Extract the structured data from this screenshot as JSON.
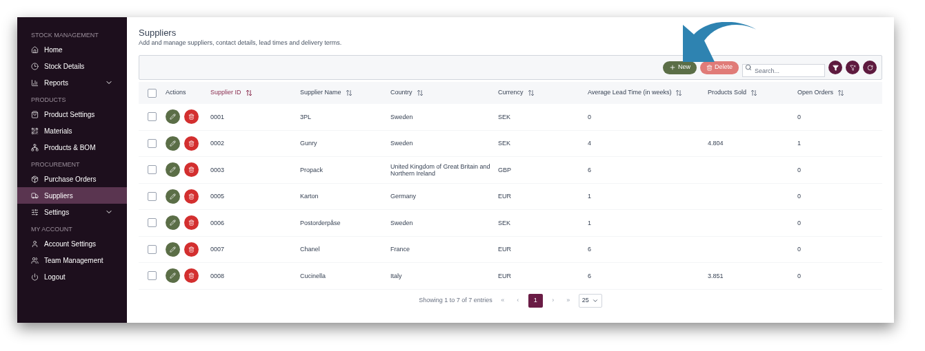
{
  "sidebar": {
    "sections": [
      {
        "title": "STOCK MANAGEMENT",
        "items": [
          {
            "label": "Home",
            "selected": false,
            "has_submenu": false
          },
          {
            "label": "Stock Details",
            "selected": false,
            "has_submenu": false
          },
          {
            "label": "Reports",
            "selected": false,
            "has_submenu": true
          }
        ]
      },
      {
        "title": "PRODUCTS",
        "items": [
          {
            "label": "Product Settings",
            "selected": false,
            "has_submenu": false
          },
          {
            "label": "Materials",
            "selected": false,
            "has_submenu": false
          },
          {
            "label": "Products & BOM",
            "selected": false,
            "has_submenu": false
          }
        ]
      },
      {
        "title": "PROCUREMENT",
        "items": [
          {
            "label": "Purchase Orders",
            "selected": false,
            "has_submenu": false
          },
          {
            "label": "Suppliers",
            "selected": true,
            "has_submenu": false
          },
          {
            "label": "Settings",
            "selected": false,
            "has_submenu": true
          }
        ]
      },
      {
        "title": "MY ACCOUNT",
        "items": [
          {
            "label": "Account Settings",
            "selected": false,
            "has_submenu": false
          },
          {
            "label": "Team Management",
            "selected": false,
            "has_submenu": false
          },
          {
            "label": "Logout",
            "selected": false,
            "has_submenu": false
          }
        ]
      }
    ]
  },
  "page": {
    "title": "Suppliers",
    "subtitle": "Add and manage suppliers, contact details, lead times and delivery terms."
  },
  "toolbar": {
    "new_button": {
      "label": "New"
    },
    "delete_button": {
      "label": "Delete",
      "disabled": true
    },
    "search": {
      "placeholder": "Search..."
    }
  },
  "table": {
    "select_all": {
      "checked": false
    },
    "actions_column": {
      "label": "Actions"
    },
    "columns": [
      {
        "label": "Supplier ID",
        "sorted": true
      },
      {
        "label": "Supplier Name",
        "sorted": false
      },
      {
        "label": "Country",
        "sorted": false
      },
      {
        "label": "Currency",
        "sorted": false
      },
      {
        "label": "Average Lead Time (in weeks)",
        "sorted": false
      },
      {
        "label": "Products Sold",
        "sorted": false
      },
      {
        "label": "Open Orders",
        "sorted": false
      }
    ],
    "rows": [
      {
        "checked": false,
        "cells": [
          "0001",
          "3PL",
          "Sweden",
          "SEK",
          "0",
          null,
          "0"
        ]
      },
      {
        "checked": false,
        "cells": [
          "0002",
          "Gunry",
          "Sweden",
          "SEK",
          "4",
          "4.804",
          "1"
        ]
      },
      {
        "checked": false,
        "cells": [
          "0003",
          "Propack",
          "United Kingdom of Great Britain and Northern Ireland",
          "GBP",
          "6",
          null,
          "0"
        ]
      },
      {
        "checked": false,
        "cells": [
          "0005",
          "Karton",
          "Germany",
          "EUR",
          "1",
          null,
          "0"
        ]
      },
      {
        "checked": false,
        "cells": [
          "0006",
          "Postorderpåse",
          "Sweden",
          "SEK",
          "1",
          null,
          "0"
        ]
      },
      {
        "checked": false,
        "cells": [
          "0007",
          "Chanel",
          "France",
          "EUR",
          "6",
          null,
          "0"
        ]
      },
      {
        "checked": false,
        "cells": [
          "0008",
          "Cucinella",
          "Italy",
          "EUR",
          "6",
          "3.851",
          "0"
        ]
      }
    ]
  },
  "footer": {
    "info": "Showing 1 to 7 of 7 entries",
    "pager": [
      {
        "label": "«",
        "kind": "nav",
        "disabled": true
      },
      {
        "label": "‹",
        "kind": "nav",
        "disabled": true
      },
      {
        "label": "1",
        "kind": "page",
        "selected": true
      },
      {
        "label": "›",
        "kind": "nav",
        "disabled": true
      },
      {
        "label": "»",
        "kind": "nav",
        "disabled": true
      }
    ],
    "page_size": "25"
  }
}
